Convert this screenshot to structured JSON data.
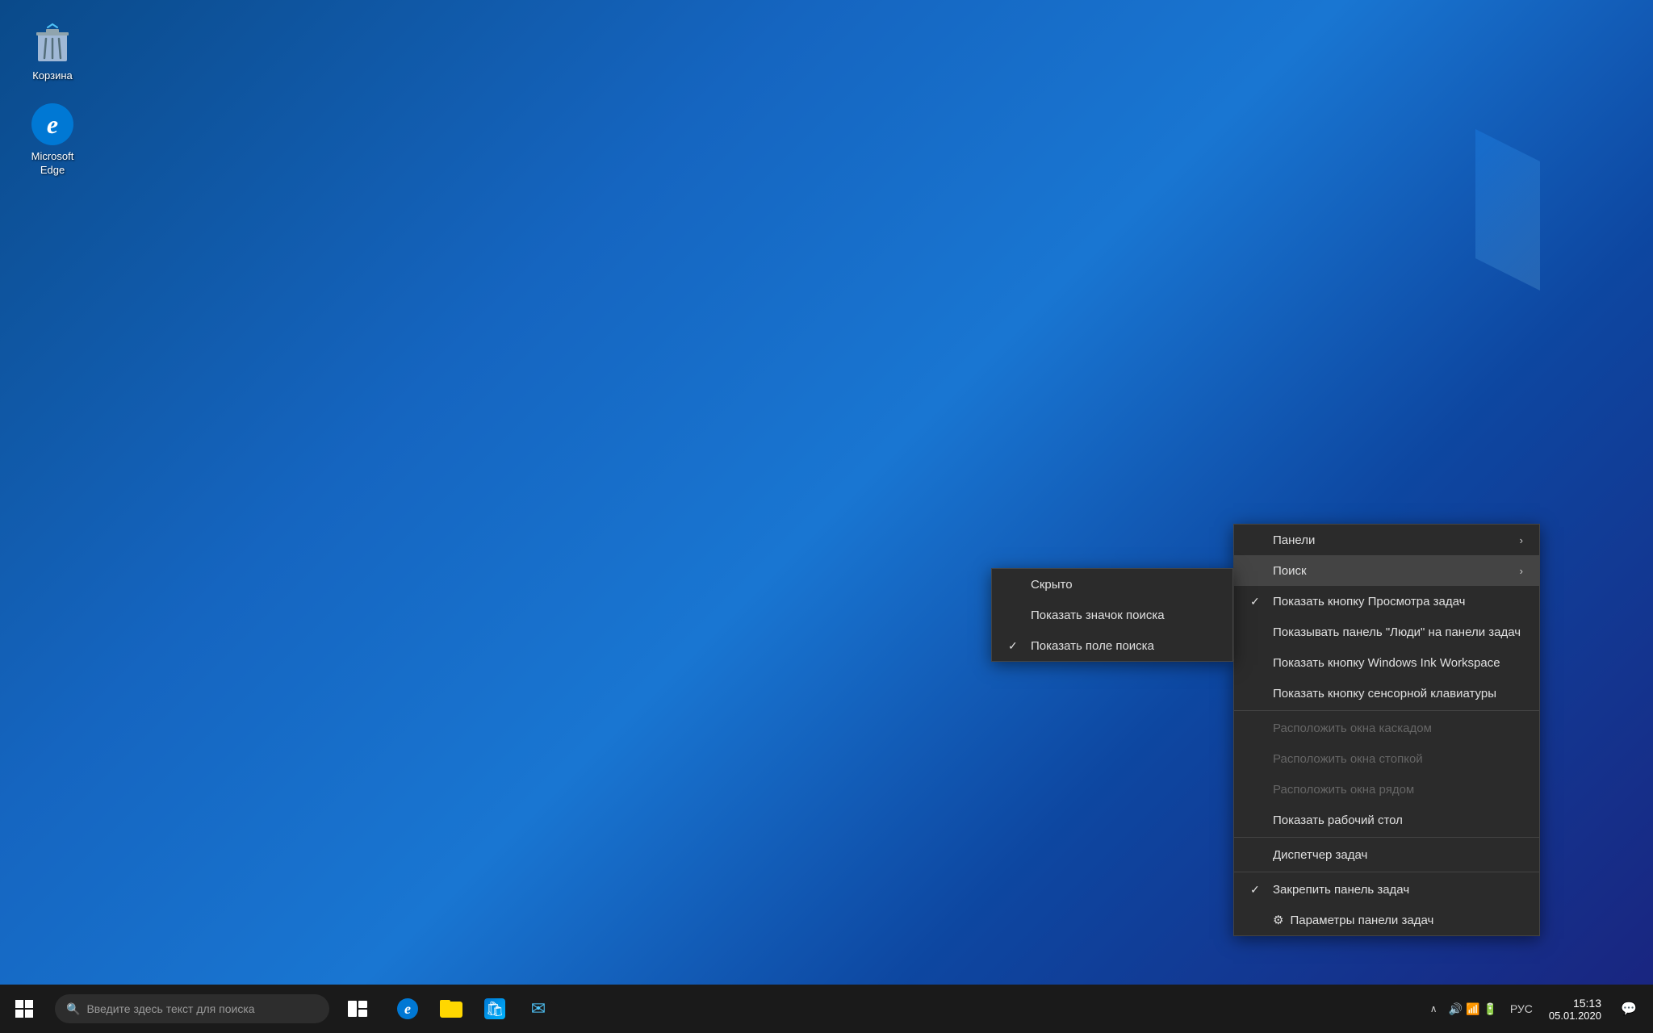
{
  "desktop": {
    "icons": [
      {
        "id": "recycle-bin",
        "label": "Корзина",
        "type": "recycle"
      },
      {
        "id": "microsoft-edge",
        "label": "Microsoft Edge",
        "type": "edge"
      }
    ]
  },
  "taskbar": {
    "search_placeholder": "Введите здесь текст для поиска",
    "clock": {
      "time": "15:13",
      "date": "05.01.2020"
    },
    "language": "РУС"
  },
  "context_menu_main": {
    "items": [
      {
        "id": "toolbars",
        "label": "Панели",
        "has_arrow": true,
        "check": false,
        "disabled": false,
        "has_gear": false
      },
      {
        "id": "search",
        "label": "Поиск",
        "has_arrow": true,
        "check": false,
        "disabled": false,
        "highlighted": true,
        "has_gear": false
      },
      {
        "id": "show-task-view",
        "label": "Показать кнопку Просмотра задач",
        "has_arrow": false,
        "check": true,
        "disabled": false,
        "has_gear": false
      },
      {
        "id": "show-people",
        "label": "Показывать панель \"Люди\" на панели задач",
        "has_arrow": false,
        "check": false,
        "disabled": false,
        "has_gear": false
      },
      {
        "id": "show-ink",
        "label": "Показать кнопку Windows Ink Workspace",
        "has_arrow": false,
        "check": false,
        "disabled": false,
        "has_gear": false
      },
      {
        "id": "show-keyboard",
        "label": "Показать кнопку сенсорной клавиатуры",
        "has_arrow": false,
        "check": false,
        "disabled": false,
        "has_gear": false
      },
      {
        "separator": true
      },
      {
        "id": "cascade",
        "label": "Расположить окна каскадом",
        "has_arrow": false,
        "check": false,
        "disabled": true,
        "has_gear": false
      },
      {
        "id": "stack",
        "label": "Расположить окна стопкой",
        "has_arrow": false,
        "check": false,
        "disabled": true,
        "has_gear": false
      },
      {
        "id": "side-by-side",
        "label": "Расположить окна рядом",
        "has_arrow": false,
        "check": false,
        "disabled": true,
        "has_gear": false
      },
      {
        "id": "show-desktop",
        "label": "Показать рабочий стол",
        "has_arrow": false,
        "check": false,
        "disabled": false,
        "has_gear": false
      },
      {
        "separator": true
      },
      {
        "id": "task-manager",
        "label": "Диспетчер задач",
        "has_arrow": false,
        "check": false,
        "disabled": false,
        "has_gear": false
      },
      {
        "separator": true
      },
      {
        "id": "lock-taskbar",
        "label": "Закрепить панель задач",
        "has_arrow": false,
        "check": true,
        "disabled": false,
        "has_gear": false
      },
      {
        "id": "taskbar-settings",
        "label": "Параметры панели задач",
        "has_arrow": false,
        "check": false,
        "disabled": false,
        "has_gear": true
      }
    ]
  },
  "context_menu_search": {
    "items": [
      {
        "id": "hidden",
        "label": "Скрыто",
        "check": false
      },
      {
        "id": "show-search-icon",
        "label": "Показать значок поиска",
        "check": false
      },
      {
        "id": "show-search-box",
        "label": "Показать поле поиска",
        "check": true
      }
    ]
  }
}
